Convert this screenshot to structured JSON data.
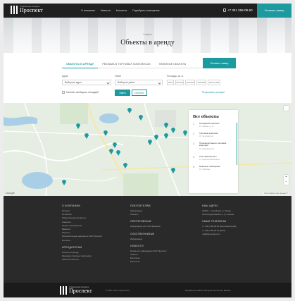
{
  "header": {
    "logo_sub": "Управляющая компания",
    "logo_name": "Проспект",
    "nav": [
      "О компании",
      "Новости",
      "Контакты",
      "Подобрать помещение"
    ],
    "phone": "+7 351 266-09-60",
    "cta": "Оставить заявку"
  },
  "hero": {
    "breadcrumb": "Главная",
    "title": "Объекты в аренду"
  },
  "tabs": {
    "items": [
      "ОБЪЕКТЫ В АРЕНДУ",
      "РЕКЛАМА В ТОРГОВЫХ КОМПЛЕКСАХ",
      "НЕЖИЛЫЕ ОБЪЕКТЫ"
    ],
    "active_index": 0,
    "cta": "Оставить заявку"
  },
  "filters": {
    "address_label": "Адрес",
    "address_value": "Выберите адрес",
    "type_label": "Район",
    "type_value": "Выберите район",
    "area_label": "Площадь, кв. м.",
    "area_options": [
      "0-50",
      "50-100",
      "100-300",
      "300-500",
      "более 500"
    ],
    "checkbox_label": "Наличие свободных площадей",
    "find_button": "Найти",
    "reset_button": "Сбросить",
    "map_link": "Результаты на карте"
  },
  "map": {
    "google_label": "Google",
    "info": "Картографические данные ©"
  },
  "objects_panel": {
    "title": "Все объекты",
    "items": [
      {
        "num": "1",
        "name": "Складской комплекс",
        "loc": "Ул. Кирова, д. 11"
      },
      {
        "num": "2",
        "name": "Торговый комплекс",
        "loc": "Ул. Энтузиастов"
      },
      {
        "num": "3",
        "name": "Производственно-торговый комплекс",
        "loc": "Ул. Дзержинского"
      },
      {
        "num": "4",
        "name": "ТРК «Мегаполис»",
        "loc": "Ул. Братьев Кашириных"
      },
      {
        "num": "5",
        "name": "Нежилые помещения",
        "loc": "Ул. Свободы"
      }
    ]
  },
  "footer": {
    "columns": [
      {
        "head": "О КОМПАНИИ",
        "links": [
          "История",
          "Коллектив",
          "Общественная активность",
          "Лицензии",
          "Акции и мероприятия",
          "Вакансии",
          "Объекты",
          "Исполнительные документы ООО Проспект",
          "Контакты"
        ],
        "sub_head": "АРЕНДАТОРАМ",
        "sub_links": [
          "Объекты в аренду",
          "Реклама в торговых комплексах",
          "Нежилые объекты"
        ]
      },
      {
        "head": "ПОКУПАТЕЛЯМ",
        "links": [
          "Информация",
          "Объекты"
        ],
        "sub_head": "ОПЕРАТИВНЫМ",
        "sub_links": [
          "Информация для собственников"
        ],
        "sub_head2": "СОБСТВЕННИКАМ",
        "sub_links2": [
          "Информация"
        ],
        "sub_head3": "НОВОСТИ",
        "sub_links3": [
          "Раскрытие информации ООО Проспект",
          "Новости",
          "Бесплатно",
          "Бесплатно"
        ]
      },
      {
        "head": "НАШ АДРЕС",
        "links": [
          "454091, г. Челябинск, ул. Труда",
          "Железнодорожный р-н, ул. Кирова"
        ],
        "sub_head": "НАШИ ТЕЛЕФОНЫ",
        "sub_links": [
          "+7 (351) 266-09-60 (многоканальный)",
          "+7 (351) 266-09-61 (факс)",
          "mail@ok-prospect.ru"
        ]
      }
    ],
    "copyright": "© 2017 ООО «Проспект»",
    "developer": "Разработка сайта: Интернет-агентство Beeline"
  },
  "colors": {
    "accent": "#1d9aa0",
    "dark": "#2a2a2a",
    "topbar": "#1f1f1f"
  }
}
